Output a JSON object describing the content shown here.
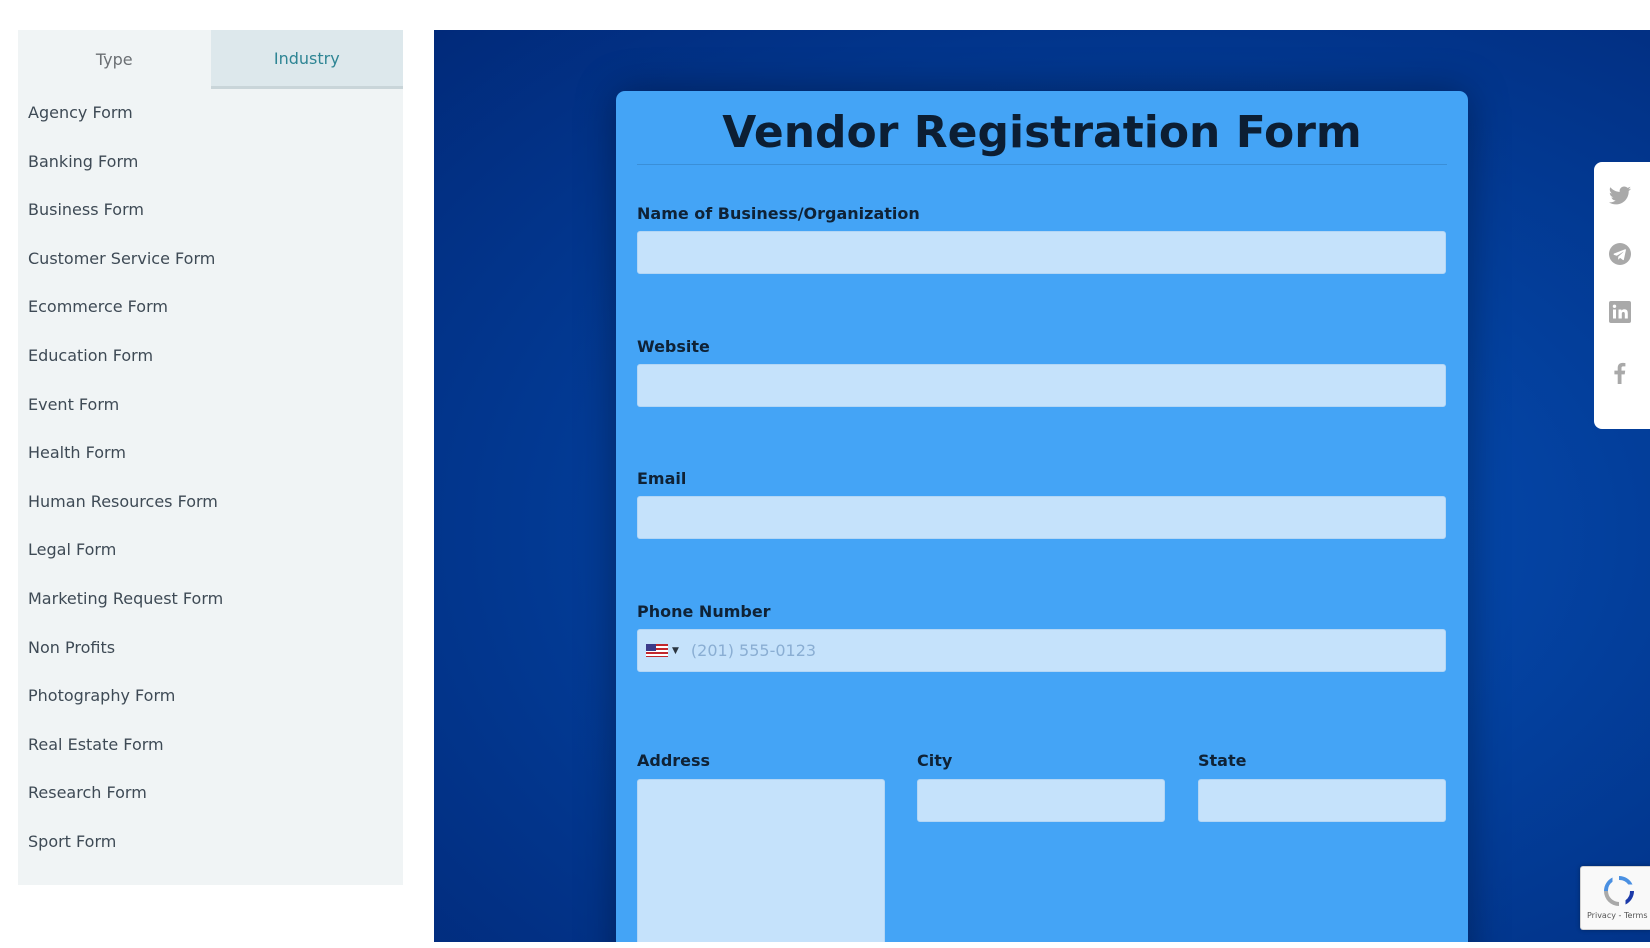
{
  "sidebar": {
    "tabs": [
      {
        "label": "Type",
        "active": false
      },
      {
        "label": "Industry",
        "active": true
      }
    ],
    "items": [
      "Agency Form",
      "Banking Form",
      "Business Form",
      "Customer Service Form",
      "Ecommerce Form",
      "Education Form",
      "Event Form",
      "Health Form",
      "Human Resources Form",
      "Legal Form",
      "Marketing Request Form",
      "Non Profits",
      "Photography Form",
      "Real Estate Form",
      "Research Form",
      "Sport Form"
    ]
  },
  "form": {
    "title": "Vendor Registration Form",
    "fields": {
      "business_name": {
        "label": "Name of Business/Organization",
        "value": ""
      },
      "website": {
        "label": "Website",
        "value": ""
      },
      "email": {
        "label": "Email",
        "value": ""
      },
      "phone": {
        "label": "Phone Number",
        "placeholder": "(201) 555-0123",
        "country_icon": "us-flag-icon"
      },
      "address": {
        "label": "Address",
        "value": ""
      },
      "city": {
        "label": "City",
        "value": ""
      },
      "state": {
        "label": "State",
        "value": ""
      }
    }
  },
  "share": {
    "icons": [
      "twitter-icon",
      "telegram-icon",
      "linkedin-icon",
      "facebook-icon"
    ]
  },
  "recaptcha": {
    "text": "Privacy - Terms"
  },
  "colors": {
    "accent_tab": "#2e8594",
    "card": "#44a4f6",
    "input": "#c5e2fb",
    "background": "#033f9c",
    "icon_gray": "#a9a9a9"
  }
}
